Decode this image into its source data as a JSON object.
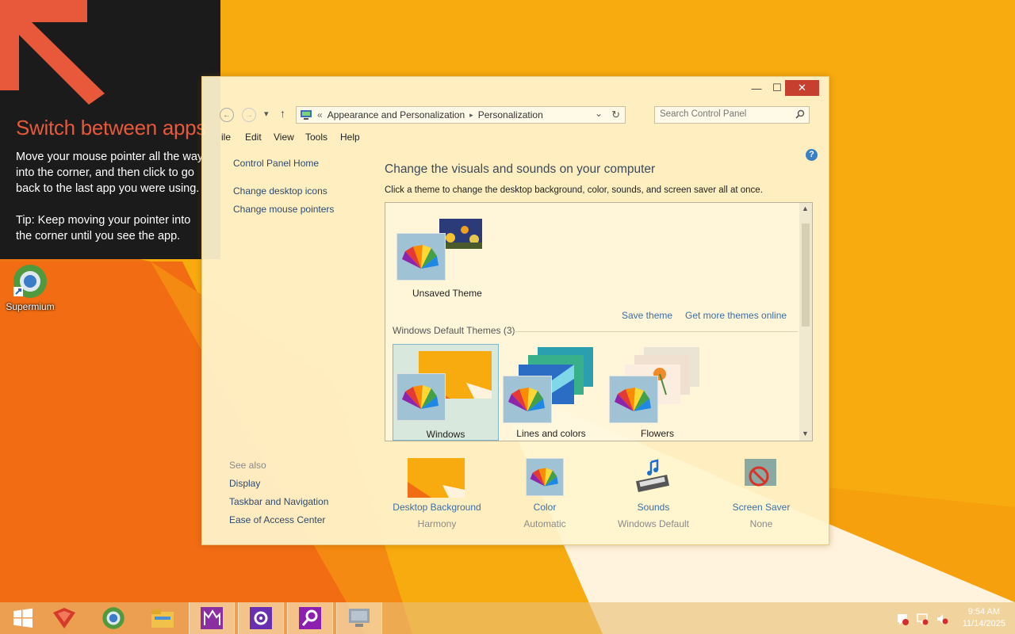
{
  "tooltip": {
    "title": "Switch between apps",
    "body": "Move your mouse pointer all the way into the corner, and then click to go back to the last app you were using.",
    "tip": "Tip: Keep moving your pointer into the corner until you see the app."
  },
  "desktop": {
    "icon_label": "Supermium"
  },
  "window": {
    "controls": {
      "minimize": "—",
      "maximize": "☐",
      "close": "✕"
    },
    "nav": {
      "back": "←",
      "forward": "→",
      "dropdown": "▾",
      "up": "↑",
      "chevrons": "«",
      "breadcrumb": [
        "Appearance and Personalization",
        "Personalization"
      ],
      "sep": "▸",
      "addr_dropdown": "⌄",
      "refresh": "↻",
      "search_placeholder": "Search Control Panel"
    },
    "menu": [
      "ile",
      "Edit",
      "View",
      "Tools",
      "Help"
    ],
    "left_pane": {
      "home": "Control Panel Home",
      "links": [
        "Change desktop icons",
        "Change mouse pointers"
      ],
      "see_also_title": "See also",
      "see_also": [
        "Display",
        "Taskbar and Navigation",
        "Ease of Access Center"
      ]
    },
    "help": "?",
    "heading": "Change the visuals and sounds on your computer",
    "subheading": "Click a theme to change the desktop background, color, sounds, and screen saver all at once.",
    "themes": {
      "unsaved_label": "Unsaved Theme",
      "save_theme": "Save theme",
      "get_more": "Get more themes online",
      "group_title": "Windows Default Themes (3)",
      "defaults": [
        "Windows",
        "Lines and colors",
        "Flowers"
      ],
      "selected": "Windows"
    },
    "bottom": [
      {
        "label": "Desktop Background",
        "value": "Harmony"
      },
      {
        "label": "Color",
        "value": "Automatic"
      },
      {
        "label": "Sounds",
        "value": "Windows Default"
      },
      {
        "label": "Screen Saver",
        "value": "None"
      }
    ]
  },
  "taskbar": {
    "time": "9:54 AM",
    "date": "11/14/2025"
  },
  "colors": {
    "accent": "#e8583a",
    "wallpaper": "#f7a90b",
    "link": "#3a6fa6"
  }
}
